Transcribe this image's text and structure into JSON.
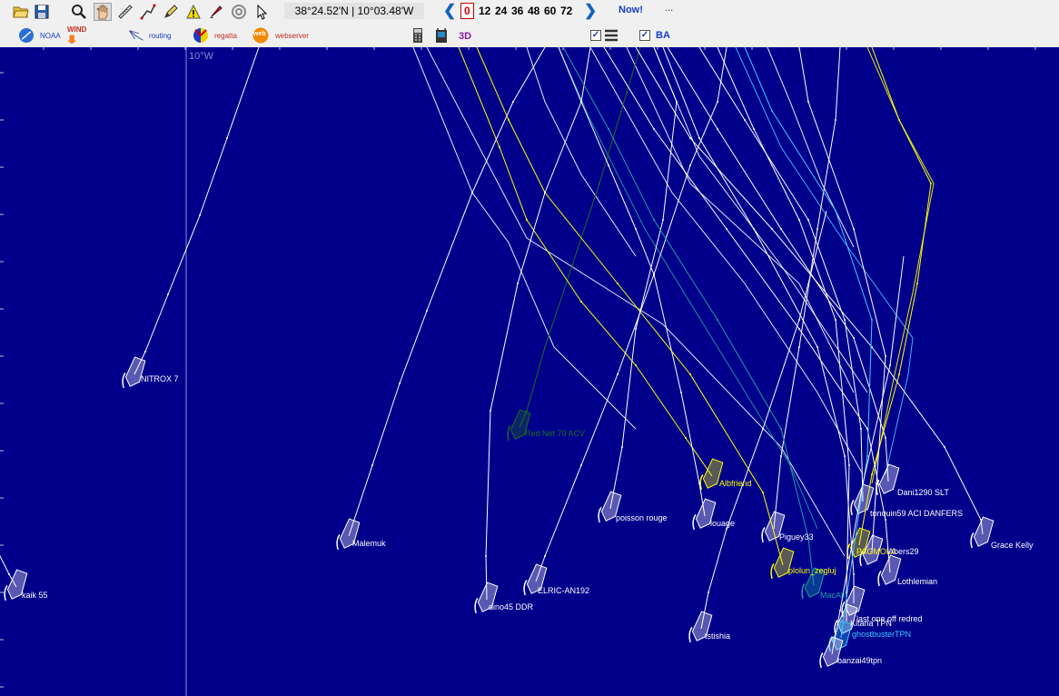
{
  "toolbar": {
    "coordinates": "38°24.52'N | 10°03.48'W",
    "forecast_hours": [
      "0",
      "12",
      "24",
      "36",
      "48",
      "60",
      "72"
    ],
    "selected_hour": "0",
    "now_label": "Now!",
    "more_label": "...",
    "noaa_label": "NOAA",
    "wind_label": "WIND",
    "routing_label": "routing",
    "regatta_label": "regatta",
    "webserver_label": "webserver",
    "web_icon_text": "web",
    "three_d_label": "3D",
    "ba_label": "BA"
  },
  "map": {
    "background": "#00008b",
    "longitude_label": "10°W"
  },
  "boats": [
    {
      "name": "NITROX 7",
      "color": "#ffffff"
    },
    {
      "name": "Red Net 79 ACV",
      "color": "#1f6b1f"
    },
    {
      "name": "Albfriend",
      "color": "#ffff00"
    },
    {
      "name": "poisson rouge",
      "color": "#ffffff"
    },
    {
      "name": "louage",
      "color": "#ffffff"
    },
    {
      "name": "Malemuk",
      "color": "#ffffff"
    },
    {
      "name": "Dani1290 SLT",
      "color": "#ffffff"
    },
    {
      "name": "tonquin59 ACI DANFERS",
      "color": "#ffffff"
    },
    {
      "name": "Piguey33",
      "color": "#ffffff"
    },
    {
      "name": "Grace Kelly",
      "color": "#ffffff"
    },
    {
      "name": "PAGMOLA",
      "color": "#ffff00"
    },
    {
      "name": "Abers29",
      "color": "#ffffff"
    },
    {
      "name": "plolun_zegluj",
      "color": "#ffff00"
    },
    {
      "name": "Lothlemian",
      "color": "#ffffff"
    },
    {
      "name": "kaik 55",
      "color": "#ffffff"
    },
    {
      "name": "ELRIC-AN192",
      "color": "#ffffff"
    },
    {
      "name": "dino45 DDR",
      "color": "#ffffff"
    },
    {
      "name": "MacAll",
      "color": "#1aa0a0"
    },
    {
      "name": "last one off redred",
      "color": "#ffffff"
    },
    {
      "name": "Kitana TPN",
      "color": "#ffffff"
    },
    {
      "name": "ghostbusterTPN",
      "color": "#40c8ff"
    },
    {
      "name": "tstishia",
      "color": "#ffffff"
    },
    {
      "name": "banzai49tpn",
      "color": "#ffffff"
    }
  ]
}
